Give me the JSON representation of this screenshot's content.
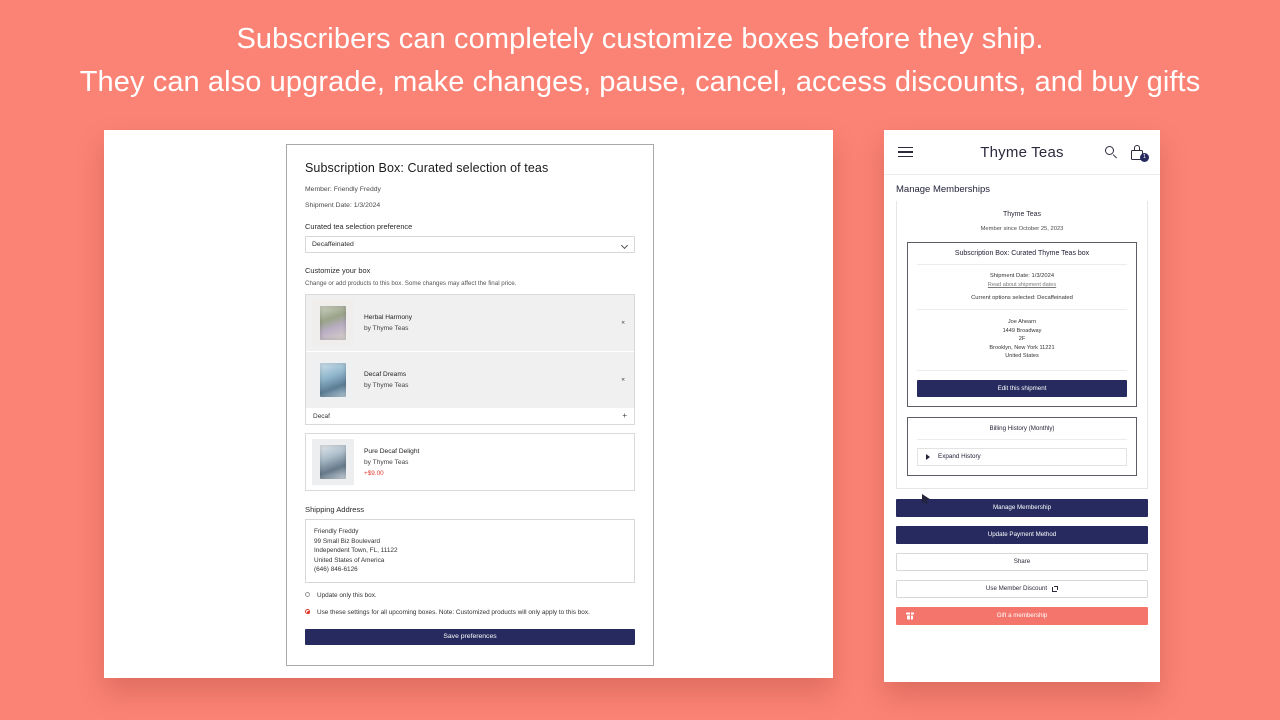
{
  "headline": {
    "line1": "Subscribers can completely customize boxes before they ship.",
    "line2": "They can also upgrade, make changes, pause, cancel, access discounts, and buy gifts"
  },
  "colors": {
    "background": "#fb8375",
    "navy": "#262a5e",
    "coral_button": "#f4756b",
    "price_red": "#e03b2f",
    "panel_white": "#ffffff"
  },
  "desktop": {
    "title": "Subscription Box: Curated selection of teas",
    "member_line": "Member: Friendly Freddy",
    "shipment_line": "Shipment Date: 1/3/2024",
    "preference_label": "Curated tea selection preference",
    "preference_value": "Decaffeinated",
    "preference_options": [
      "Decaffeinated"
    ],
    "customize_heading": "Customize your box",
    "customize_sub": "Change or add products to this box. Some changes may affect the final price.",
    "products": [
      {
        "name": "Herbal Harmony",
        "vendor": "by Thyme Teas",
        "remove_label": "×"
      },
      {
        "name": "Decaf Dreams",
        "vendor": "by Thyme Teas",
        "remove_label": "×"
      }
    ],
    "variant_row": {
      "label": "Decaf",
      "add_label": "+"
    },
    "addon": {
      "name": "Pure Decaf Delight",
      "vendor": "by Thyme Teas",
      "price": "+$9.00"
    },
    "shipping_heading": "Shipping Address",
    "address": [
      "Friendly Freddy",
      "99 Small Biz Boulevard",
      "Independent Town, FL, 11122",
      "United States of America",
      "(646) 846-6126"
    ],
    "radio_options": [
      {
        "label": "Update only this box.",
        "selected": false
      },
      {
        "label": "Use these settings for all upcoming boxes. Note: Customized products will only apply to this box.",
        "selected": true
      }
    ],
    "save_label": "Save preferences"
  },
  "mobile": {
    "brand": "Thyme Teas",
    "cart_badge": "1",
    "page_title": "Manage Memberships",
    "shop_name": "Thyme Teas",
    "member_since": "Member since October 25, 2023",
    "card": {
      "title": "Subscription Box: Curated Thyme Teas box",
      "shipment_date": "Shipment Date: 1/3/2024",
      "read_link": "Read about shipment dates",
      "current_options": "Current options selected: Decaffeinated",
      "address": [
        "Joe Ahearn",
        "1449 Broadway",
        "2F",
        "Brooklyn, New York 11221",
        "United States"
      ],
      "edit_label": "Edit this shipment"
    },
    "billing": {
      "title": "Billing History (Monthly)",
      "expand_label": "Expand History"
    },
    "actions": [
      {
        "label": "Manage Membership",
        "style": "dark"
      },
      {
        "label": "Update Payment Method",
        "style": "dark"
      },
      {
        "label": "Share",
        "style": "light"
      },
      {
        "label": "Use Member Discount",
        "style": "light",
        "external": true
      },
      {
        "label": "Gift a membership",
        "style": "coral",
        "gift": true
      }
    ]
  }
}
